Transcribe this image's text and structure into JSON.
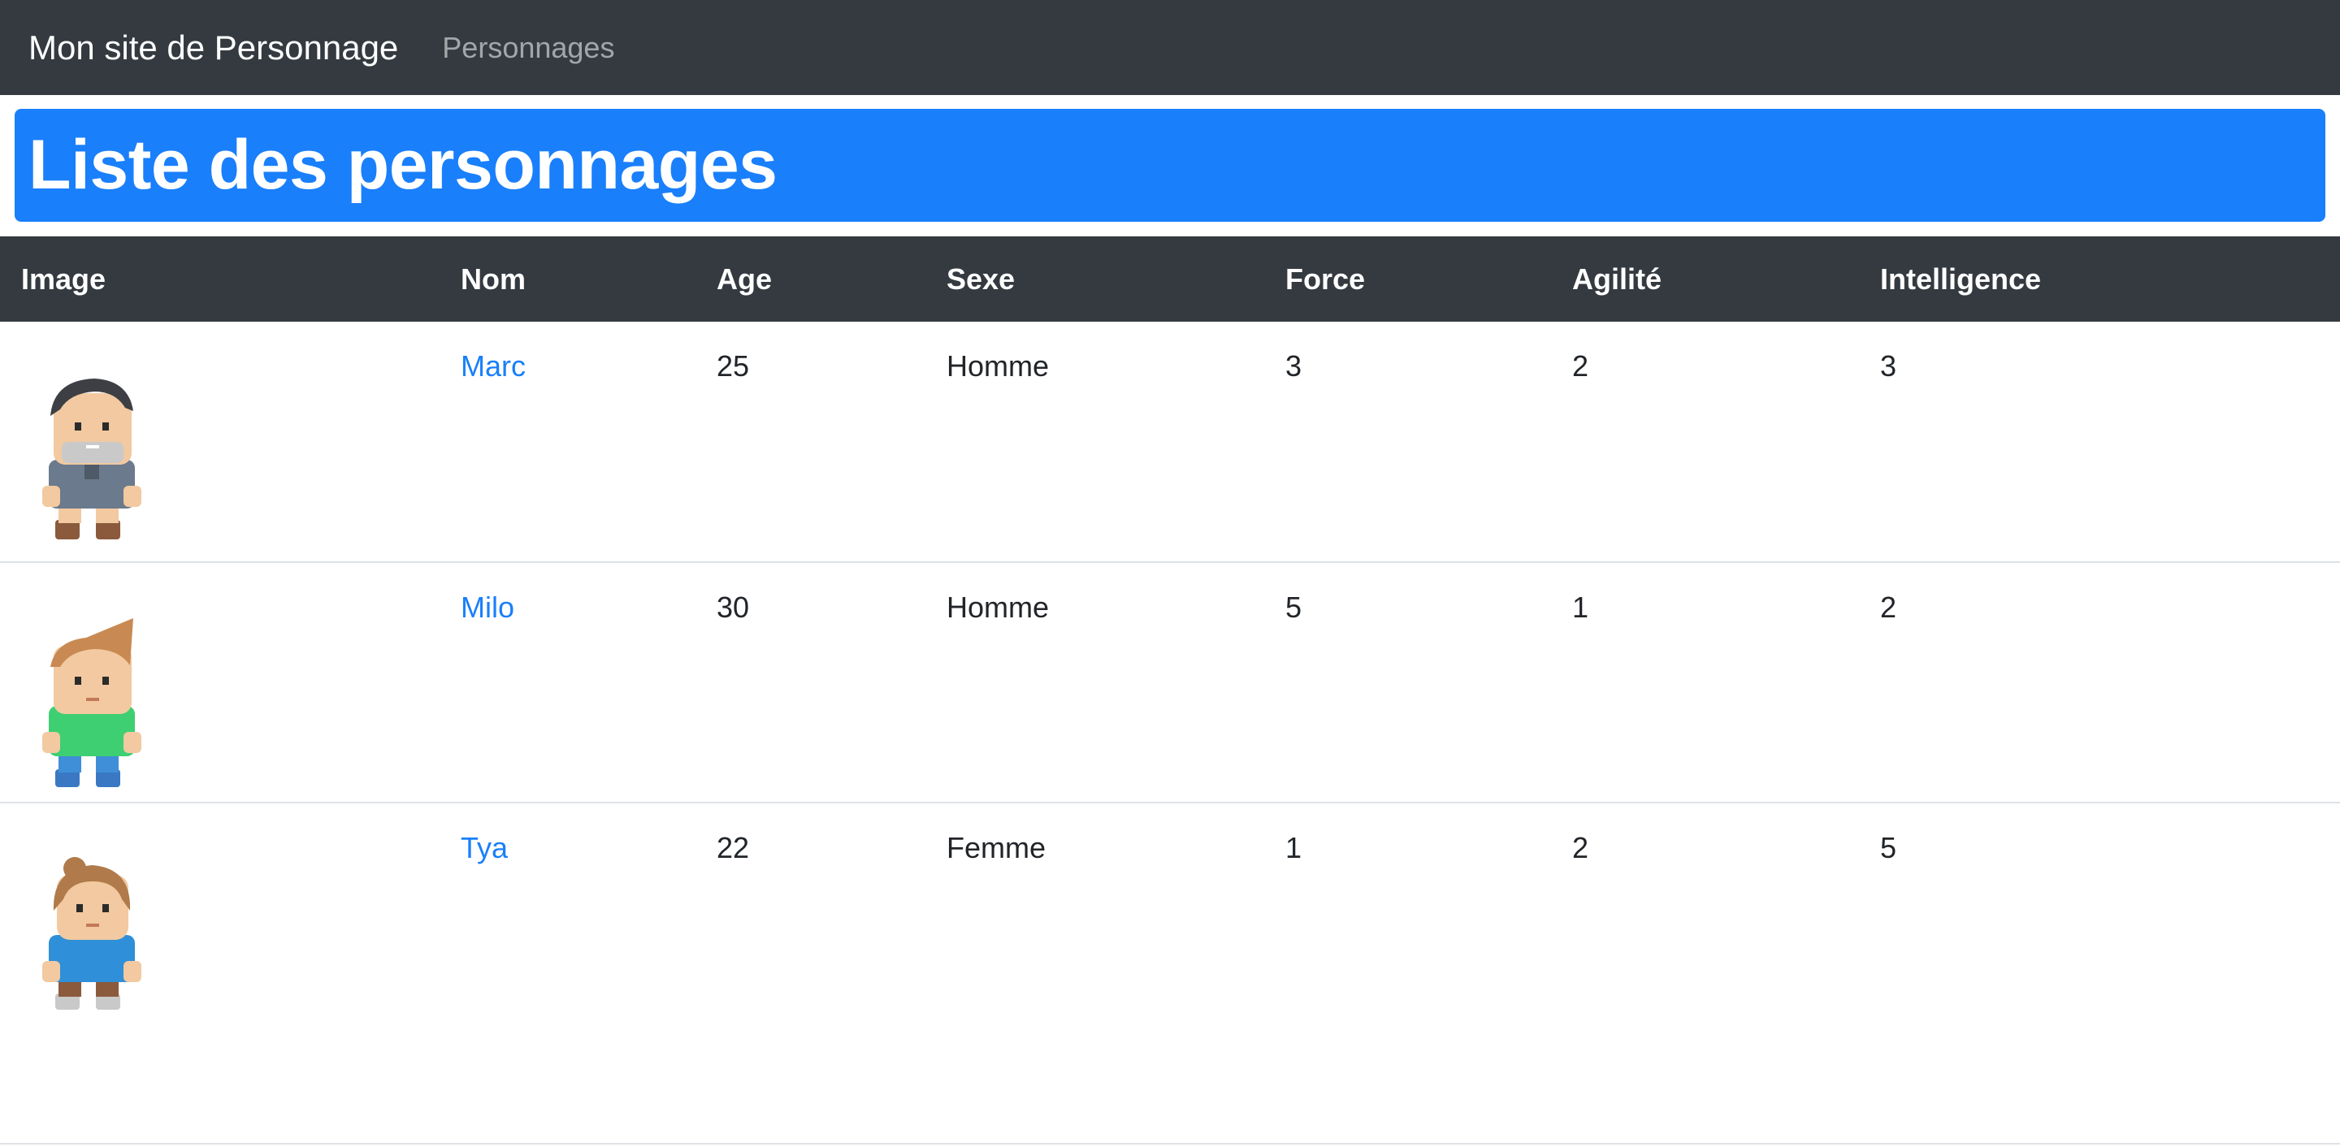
{
  "navbar": {
    "brand": "Mon site de Personnage",
    "link": "Personnages"
  },
  "page": {
    "title": "Liste des personnages"
  },
  "table": {
    "headers": [
      "Image",
      "Nom",
      "Age",
      "Sexe",
      "Force",
      "Agilité",
      "Intelligence"
    ],
    "rows": [
      {
        "nom": "Marc",
        "age": "25",
        "sexe": "Homme",
        "force": "3",
        "agilite": "2",
        "intelligence": "3",
        "avatar": "character-marc-icon"
      },
      {
        "nom": "Milo",
        "age": "30",
        "sexe": "Homme",
        "force": "5",
        "agilite": "1",
        "intelligence": "2",
        "avatar": "character-milo-icon"
      },
      {
        "nom": "Tya",
        "age": "22",
        "sexe": "Femme",
        "force": "1",
        "agilite": "2",
        "intelligence": "5",
        "avatar": "character-tya-icon"
      }
    ]
  },
  "colors": {
    "navbar_bg": "#343a40",
    "primary": "#1a7ffb",
    "header_bg": "#343a40"
  }
}
